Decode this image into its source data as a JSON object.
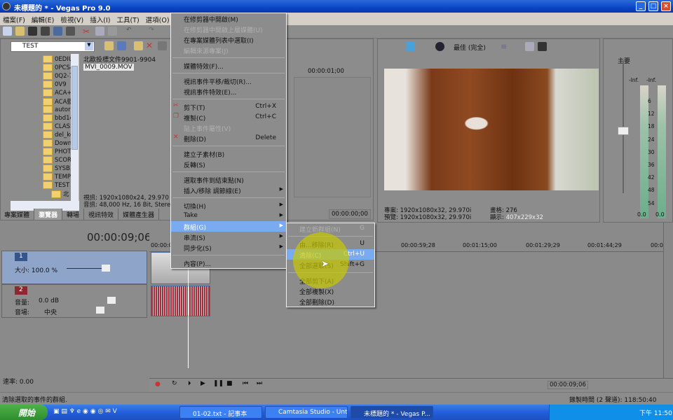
{
  "window": {
    "title": "未標題的 * - Vegas Pro 9.0",
    "min": "_",
    "max": "□",
    "close": "×"
  },
  "menubar": [
    "檔案(F)",
    "編輯(E)",
    "檢視(V)",
    "插入(I)",
    "工具(T)",
    "選項(O)",
    "說"
  ],
  "explorer": {
    "path": "TEST",
    "tree": [
      "0EDIU",
      "0PCS4",
      "0Q2-7",
      "0V9",
      "ACA+",
      "ACA藍",
      "autoru",
      "bbd1e",
      "CLASS",
      "del_ke",
      "Downl",
      "PHOTO",
      "SCOR",
      "SYSB.",
      "TEMP",
      "TEST",
      "北"
    ],
    "files": [
      "北歐投標文件9901-9904",
      "MVI_0009.MOV"
    ],
    "info": [
      "視訊: 1920x1080x24, 29.970 fps 3",
      "音訊: 48,000 Hz, 16 Bit, Stereo, 00"
    ],
    "tabs": [
      "專案媒體",
      "瀏覽器",
      "轉場",
      "視訊特效",
      "媒體產生器"
    ],
    "active_tab": 1
  },
  "trimmer": {
    "ruler": "00:00:01;00",
    "time": "00:00:00;00"
  },
  "preview": {
    "quality": "最佳 (完全)",
    "project": "專案: 1920x1080x32, 29.970i",
    "preview": "預覽: 1920x1080x32, 29.970i",
    "frame": "畫格: 276",
    "display_label": "顯示:",
    "display": "407x229x32"
  },
  "mixer": {
    "title": "主要",
    "peaks": [
      "-Inf.",
      "-Inf."
    ],
    "scale": [
      "6",
      "12",
      "18",
      "24",
      "30",
      "36",
      "42",
      "48",
      "54"
    ],
    "values": [
      "0.0",
      "0.0"
    ]
  },
  "timeline": {
    "time": "00:00:09;06",
    "ruler": [
      "00:00:0",
      "00:00:59;28",
      "00:01:15;00",
      "00:01:29;29",
      "00:01:44;29",
      "00:0"
    ],
    "track1": {
      "num": "1",
      "level": "大小: 100.0 %"
    },
    "track2": {
      "num": "2",
      "volume_label": "音量:",
      "volume": "0.0 dB",
      "pan_label": "音場:",
      "pan": "中央"
    },
    "rate": "速率: 0.00",
    "transport_time": "00:00:09;06"
  },
  "status": {
    "message": "清除選取的事件的群組.",
    "record": "錄製時間 (2 聲道): 118:50:40"
  },
  "context_menu": [
    {
      "label": "在修剪器中開啟(M)"
    },
    {
      "label": "在修剪器中開啟上層媒體(U)",
      "disabled": true
    },
    {
      "label": "在專案媒體列表中選取(I)"
    },
    {
      "label": "編輯來源專案(J)",
      "disabled": true
    },
    {
      "sep": true
    },
    {
      "label": "媒體特效(F)..."
    },
    {
      "sep": true
    },
    {
      "label": "視訊事件平移/裁切(R)..."
    },
    {
      "label": "視訊事件特效(E)..."
    },
    {
      "sep": true
    },
    {
      "label": "剪下(T)",
      "shortcut": "Ctrl+X",
      "icon": "scissors-icon"
    },
    {
      "label": "複製(C)",
      "shortcut": "Ctrl+C",
      "icon": "copy-icon"
    },
    {
      "label": "貼上事件屬性(V)",
      "disabled": true
    },
    {
      "label": "刪除(D)",
      "shortcut": "Delete",
      "icon": "delete-icon"
    },
    {
      "sep": true
    },
    {
      "label": "建立子素材(B)"
    },
    {
      "label": "反轉(S)"
    },
    {
      "sep": true
    },
    {
      "label": "選取事件到結束點(N)"
    },
    {
      "label": "插入/移除 調節線(E)",
      "submenu": true
    },
    {
      "sep": true
    },
    {
      "label": "切換(H)",
      "submenu": true
    },
    {
      "label": "Take",
      "submenu": true
    },
    {
      "label": "群組(G)",
      "submenu": true,
      "highlighted": true
    },
    {
      "label": "串流(S)",
      "submenu": true
    },
    {
      "label": "同步化(S)",
      "submenu": true
    },
    {
      "sep": true
    },
    {
      "label": "內容(P)..."
    }
  ],
  "submenu": [
    {
      "label": "建立新群組(N)",
      "shortcut": "G",
      "disabled": true
    },
    {
      "sep": true
    },
    {
      "label": "由...移除(R)",
      "shortcut": "U"
    },
    {
      "label": "清除(C)",
      "shortcut": "Ctrl+U",
      "highlighted": true
    },
    {
      "label": "全部選取(S)",
      "shortcut": "Shift+G"
    },
    {
      "sep": true
    },
    {
      "label": "全部剪下(A)"
    },
    {
      "label": "全部複製(X)"
    },
    {
      "label": "全部刪除(D)"
    }
  ],
  "taskbar": {
    "start": "開始",
    "tasks": [
      "01-02.txt - 記事本",
      "Camtasia Studio - Unti...",
      "未標題的 * - Vegas P..."
    ],
    "clock": "下午 11:50"
  },
  "colors": {
    "titlebar": "#0a46c8",
    "highlight": "#7aaaf0",
    "panel": "#8c8c8c",
    "audio_wave": "#a03040"
  }
}
